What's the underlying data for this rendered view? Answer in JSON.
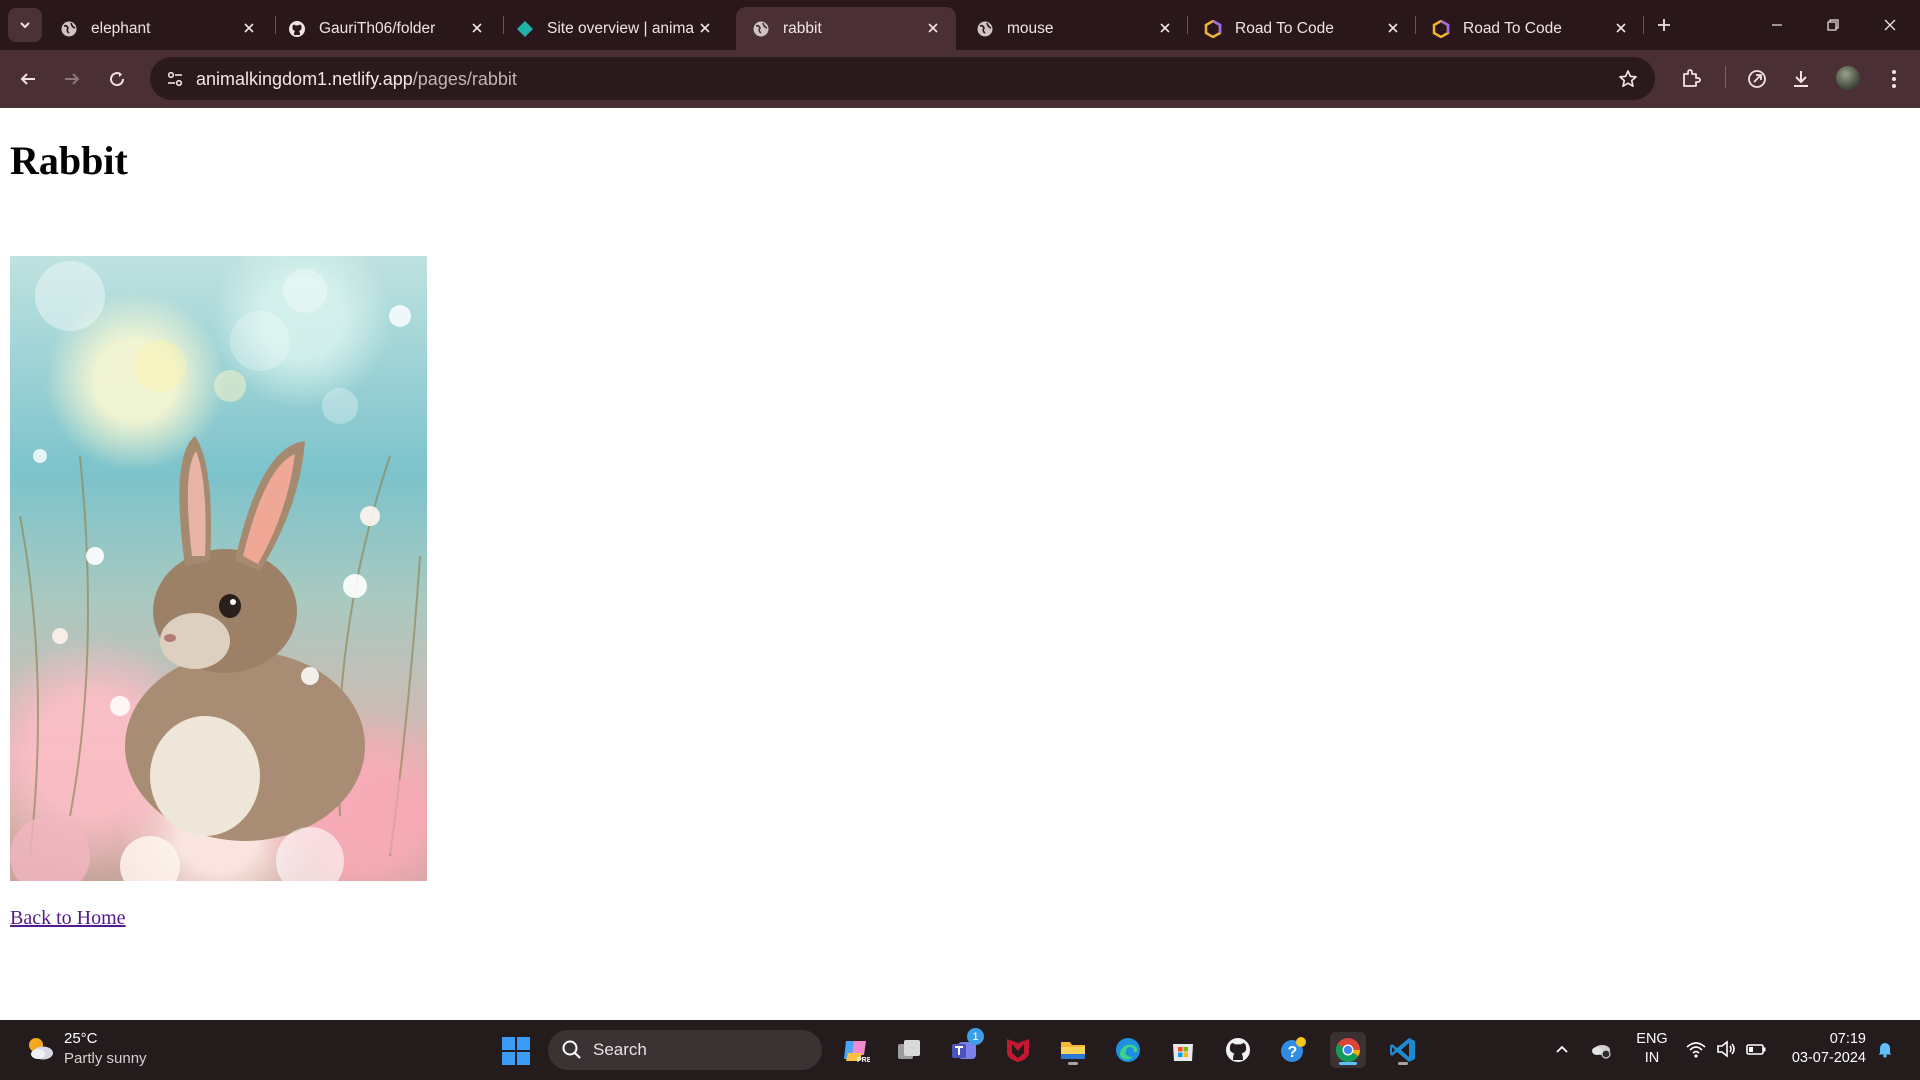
{
  "browser": {
    "tabs": [
      {
        "title": "elephant",
        "favicon": "globe-icon",
        "active": false
      },
      {
        "title": "GauriTh06/folder",
        "favicon": "github-icon",
        "active": false
      },
      {
        "title": "Site overview | anima",
        "favicon": "netlify-icon",
        "active": false
      },
      {
        "title": "rabbit",
        "favicon": "globe-icon",
        "active": true
      },
      {
        "title": "mouse",
        "favicon": "globe-icon",
        "active": false
      },
      {
        "title": "Road To Code",
        "favicon": "roadtocode-icon",
        "active": false
      },
      {
        "title": "Road To Code",
        "favicon": "roadtocode-icon",
        "active": false
      }
    ],
    "url_host": "animalkingdom1.netlify.app",
    "url_path": "/pages/rabbit"
  },
  "page": {
    "heading": "Rabbit",
    "image_subject": "rabbit among flowers",
    "back_link": "Back to Home"
  },
  "taskbar": {
    "weather_temp": "25°C",
    "weather_desc": "Partly sunny",
    "search_label": "Search",
    "teams_badge": "1",
    "lang_line1": "ENG",
    "lang_line2": "IN",
    "time": "07:19",
    "date": "03-07-2024"
  },
  "colors": {
    "tabstrip": "#2a171b",
    "toolbar": "#4a3035",
    "omnibox": "#2b1a1d",
    "taskbar": "#231b1c",
    "link_visited": "#551a8b"
  }
}
